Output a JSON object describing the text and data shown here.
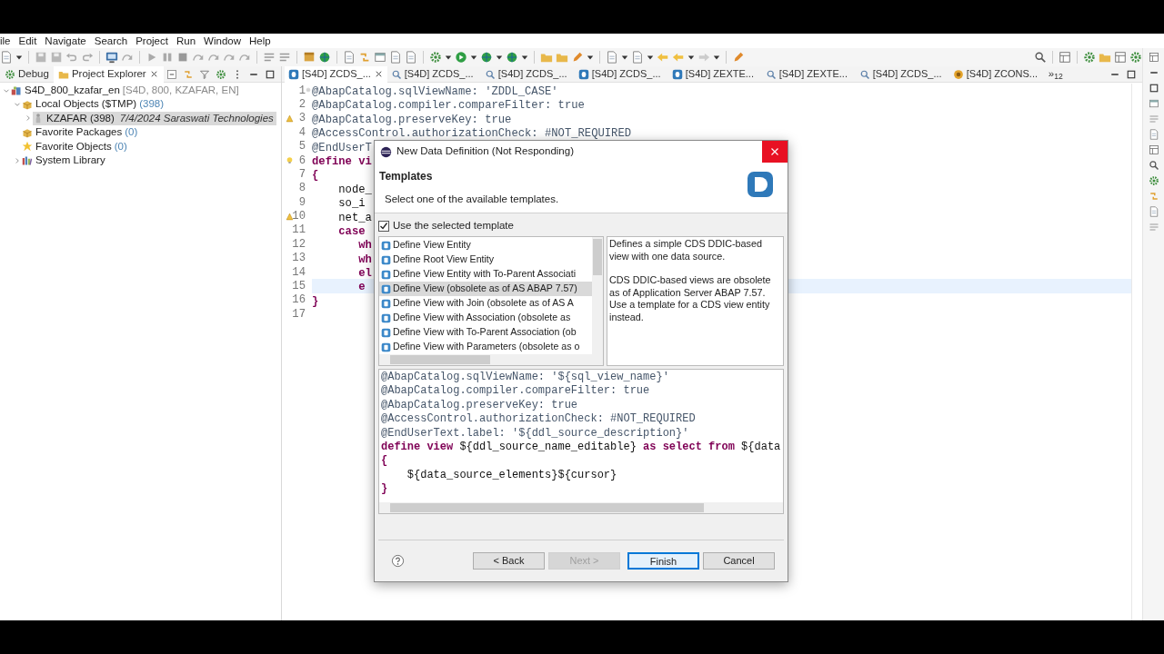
{
  "menu": [
    "ile",
    "Edit",
    "Navigate",
    "Search",
    "Project",
    "Run",
    "Window",
    "Help"
  ],
  "left_panel": {
    "tabs": [
      {
        "label": "Debug",
        "kind": "debug",
        "selected": false
      },
      {
        "label": "Project Explorer",
        "kind": "explorer",
        "selected": true
      }
    ],
    "tree": [
      {
        "label": "S4D_800_kzafar_en",
        "decoration": {
          "text": "[S4D, 800, KZAFAR, EN]",
          "kind": "qualifier"
        },
        "kind": "project",
        "expanded": true,
        "selected": false,
        "children": [
          {
            "label": "Local Objects ($TMP)",
            "decoration": {
              "text": "(398)",
              "kind": "count"
            },
            "kind": "package",
            "expanded": true,
            "selected": false,
            "children": [
              {
                "label": "KZAFAR (398)",
                "decoration": {
                  "text": "7/4/2024 Saraswati Technologies",
                  "kind": "note"
                },
                "kind": "user",
                "expanded": false,
                "selected": true
              }
            ]
          },
          {
            "label": "Favorite Packages",
            "decoration": {
              "text": "(0)",
              "kind": "count"
            },
            "kind": "package",
            "selected": false
          },
          {
            "label": "Favorite Objects",
            "decoration": {
              "text": "(0)",
              "kind": "count"
            },
            "kind": "star",
            "selected": false
          },
          {
            "label": "System Library",
            "kind": "library",
            "expanded": false,
            "selected": false
          }
        ]
      }
    ]
  },
  "editor": {
    "tabs": [
      {
        "label": "[S4D] ZCDS_...",
        "kind": "ddl",
        "selected": true
      },
      {
        "label": "[S4D] ZCDS_...",
        "kind": "view",
        "selected": false
      },
      {
        "label": "[S4D] ZCDS_...",
        "kind": "view",
        "selected": false
      },
      {
        "label": "[S4D] ZCDS_...",
        "kind": "ddl",
        "selected": false
      },
      {
        "label": "[S4D] ZEXTE...",
        "kind": "ddl",
        "selected": false
      },
      {
        "label": "[S4D] ZEXTE...",
        "kind": "view",
        "selected": false
      },
      {
        "label": "[S4D] ZCDS_...",
        "kind": "view",
        "selected": false
      },
      {
        "label": "[S4D] ZCONS...",
        "kind": "class",
        "selected": false
      }
    ],
    "overflow": "»$_{12}$",
    "lines": [
      {
        "number": "1",
        "kind": "foldable",
        "current": false,
        "segments": [
          {
            "text": "@AbapCatalog.sqlViewName: 'ZDDL_CASE'",
            "kind": "annotation"
          }
        ]
      },
      {
        "number": "2",
        "kind": "plain",
        "current": false,
        "segments": [
          {
            "text": "@AbapCatalog.compiler.compareFilter: true",
            "kind": "annotation"
          }
        ]
      },
      {
        "number": "3",
        "kind": "warning",
        "current": false,
        "segments": [
          {
            "text": "@AbapCatalog.preserveKey: true",
            "kind": "annotation"
          }
        ]
      },
      {
        "number": "4",
        "kind": "plain",
        "current": false,
        "segments": [
          {
            "text": "@AccessControl.authorizationCheck: #NOT_REQUIRED",
            "kind": "annotation"
          }
        ]
      },
      {
        "number": "5",
        "kind": "plain",
        "current": false,
        "segments": [
          {
            "text": "@EndUserT",
            "kind": "annotation"
          }
        ]
      },
      {
        "number": "6",
        "kind": "quickfix",
        "current": false,
        "segments": [
          {
            "text": "define vi",
            "kind": "keyword"
          }
        ]
      },
      {
        "number": "7",
        "kind": "plain",
        "current": false,
        "segments": [
          {
            "text": "{",
            "kind": "keyword"
          }
        ]
      },
      {
        "number": "8",
        "kind": "plain",
        "current": false,
        "segments": [
          {
            "text": "    node_",
            "kind": "plain"
          }
        ]
      },
      {
        "number": "9",
        "kind": "plain",
        "current": false,
        "segments": [
          {
            "text": "    so_i",
            "kind": "plain"
          }
        ]
      },
      {
        "number": "10",
        "kind": "warning",
        "current": false,
        "segments": [
          {
            "text": "    net_a",
            "kind": "plain"
          }
        ]
      },
      {
        "number": "11",
        "kind": "plain",
        "current": false,
        "segments": [
          {
            "text": "    case",
            "kind": "keyword"
          }
        ]
      },
      {
        "number": "12",
        "kind": "plain",
        "current": false,
        "segments": [
          {
            "text": "       wh",
            "kind": "keyword"
          }
        ]
      },
      {
        "number": "13",
        "kind": "plain",
        "current": false,
        "segments": [
          {
            "text": "       wh",
            "kind": "keyword"
          }
        ]
      },
      {
        "number": "14",
        "kind": "plain",
        "current": false,
        "segments": [
          {
            "text": "       el",
            "kind": "keyword"
          }
        ]
      },
      {
        "number": "15",
        "kind": "plain",
        "current": true,
        "segments": [
          {
            "text": "       e",
            "kind": "keyword"
          }
        ]
      },
      {
        "number": "16",
        "kind": "plain",
        "current": false,
        "segments": [
          {
            "text": "}",
            "kind": "keyword"
          }
        ]
      },
      {
        "number": "17",
        "kind": "plain",
        "current": false
      }
    ]
  },
  "dialog": {
    "title": "New Data Definition (Not Responding)",
    "heading": "Templates",
    "message": "Select one of the available templates.",
    "use_template": {
      "label": "Use the selected template",
      "checked": true
    },
    "templates": [
      {
        "label": "Define View Entity",
        "selected": false
      },
      {
        "label": "Define Root View Entity",
        "selected": false
      },
      {
        "label": "Define View Entity with To-Parent Associati",
        "selected": false
      },
      {
        "label": "Define View (obsolete as of AS ABAP 7.57)",
        "selected": true
      },
      {
        "label": "Define View with Join (obsolete as of AS A",
        "selected": false
      },
      {
        "label": "Define View with Association (obsolete as",
        "selected": false
      },
      {
        "label": "Define View with To-Parent Association (ob",
        "selected": false
      },
      {
        "label": "Define View with Parameters (obsolete as o",
        "selected": false
      }
    ],
    "description": [
      "Defines a simple CDS DDIC-based view with one data source.",
      "CDS DDIC-based views are obsolete as of Application Server ABAP 7.57. Use a template for a CDS view entity instead."
    ],
    "preview": [
      [
        {
          "text": "@AbapCatalog.sqlViewName: '${sql_view_name}'",
          "kind": "annotation"
        }
      ],
      [
        {
          "text": "@AbapCatalog.compiler.compareFilter: true",
          "kind": "annotation"
        }
      ],
      [
        {
          "text": "@AbapCatalog.preserveKey: true",
          "kind": "annotation"
        }
      ],
      [
        {
          "text": "@AccessControl.authorizationCheck: #NOT_REQUIRED",
          "kind": "annotation"
        }
      ],
      [
        {
          "text": "@EndUserText.label: '${ddl_source_description}'",
          "kind": "annotation"
        }
      ],
      [
        {
          "text": "define view",
          "kind": "keyword"
        },
        {
          "text": " ${ddl_source_name_editable} ",
          "kind": "plain"
        },
        {
          "text": "as select from",
          "kind": "keyword"
        },
        {
          "text": " ${data",
          "kind": "plain"
        }
      ],
      [
        {
          "text": "{",
          "kind": "keyword"
        }
      ],
      [
        {
          "text": "    ${data_source_elements}${cursor}",
          "kind": "plain"
        }
      ],
      [
        {
          "text": "}",
          "kind": "keyword"
        }
      ]
    ],
    "buttons": [
      {
        "label": "< Back",
        "disabled": false,
        "default": false
      },
      {
        "label": "Next >",
        "disabled": true,
        "default": false
      },
      {
        "label": "Finish",
        "disabled": false,
        "default": true
      },
      {
        "label": "Cancel",
        "disabled": false,
        "default": false
      }
    ]
  }
}
